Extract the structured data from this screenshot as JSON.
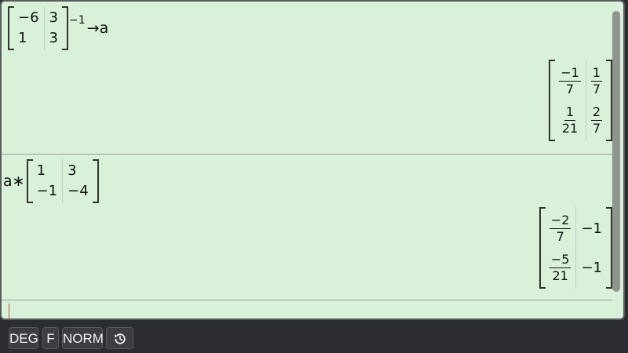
{
  "history": [
    {
      "input": {
        "matrix": [
          [
            "−6",
            "3"
          ],
          [
            "1",
            "3"
          ]
        ],
        "superscript": "−1",
        "operator": "→",
        "variable": "a"
      },
      "result": [
        [
          {
            "num": "−1",
            "den": "7"
          },
          {
            "num": "1",
            "den": "7"
          }
        ],
        [
          {
            "num": "1",
            "den": "21"
          },
          {
            "num": "2",
            "den": "7"
          }
        ]
      ]
    },
    {
      "input": {
        "prefix": "a∗",
        "matrix": [
          [
            "1",
            "3"
          ],
          [
            "−1",
            "−4"
          ]
        ]
      },
      "result": [
        [
          {
            "num": "−2",
            "den": "7"
          },
          {
            "value": "−1"
          }
        ],
        [
          {
            "num": "−5",
            "den": "21"
          },
          {
            "value": "−1"
          }
        ]
      ]
    }
  ],
  "statusbar": {
    "angle_mode": "DEG",
    "format_mode": "F",
    "display_mode": "NORM",
    "history_icon": "history-icon"
  },
  "colors": {
    "screen_bg": "#d9f1d9",
    "frame": "#2b2d31",
    "cursor": "#d0502a"
  }
}
